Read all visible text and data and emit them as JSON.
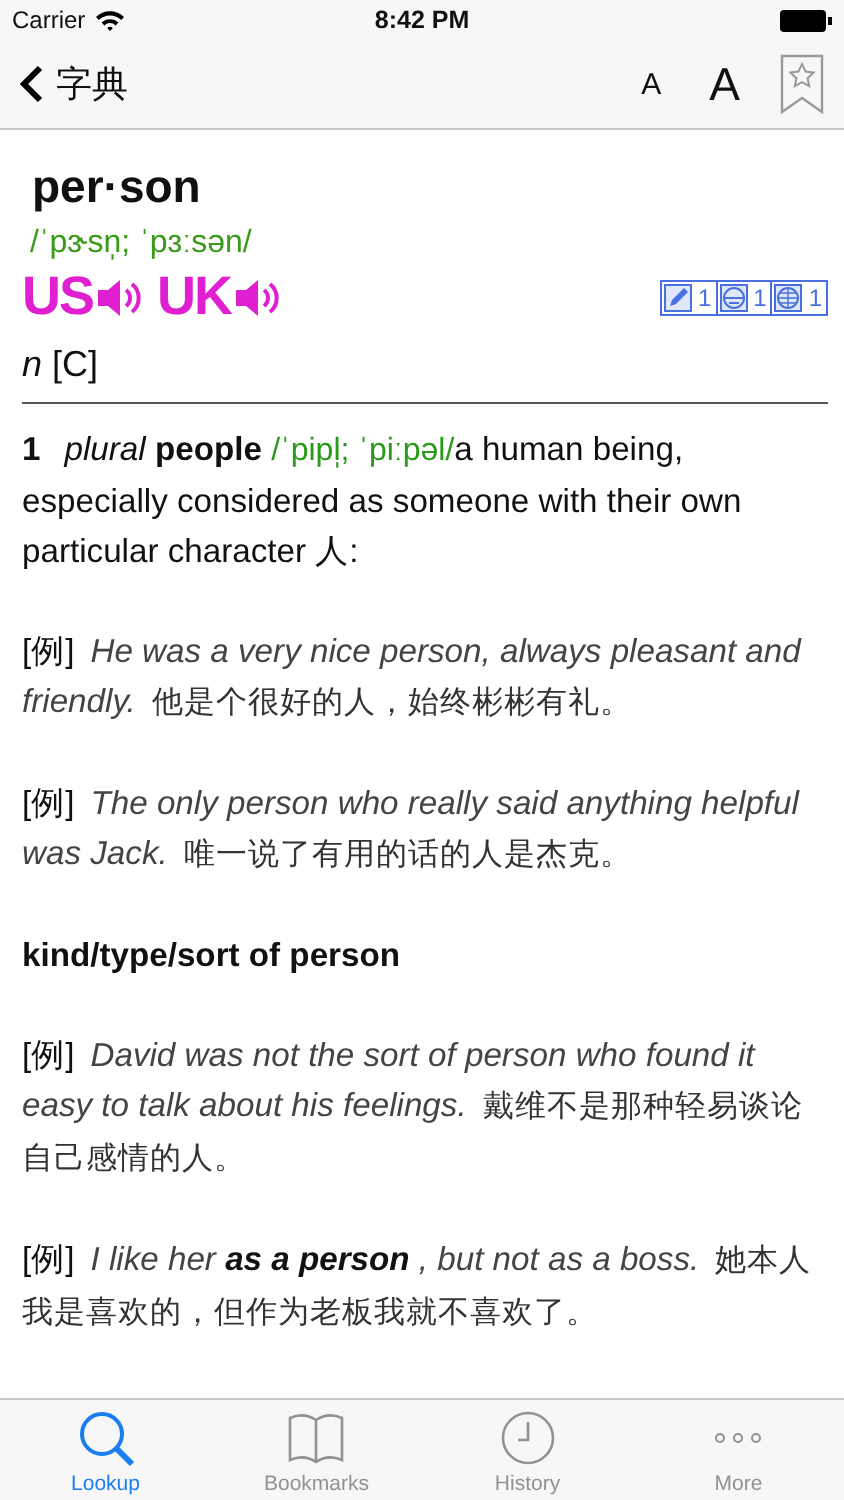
{
  "status_bar": {
    "carrier": "Carrier",
    "time": "8:42 PM"
  },
  "nav_bar": {
    "back_label": "字典",
    "font_buttons": [
      {
        "label": "A",
        "kind": "smaller"
      },
      {
        "label": "A",
        "kind": "larger"
      }
    ],
    "bookmarked": false
  },
  "entry": {
    "headword": "per·son",
    "pronunciation": "/ˈpɝsn̩; ˈpɜːsən/",
    "audio": [
      {
        "label": "US"
      },
      {
        "label": "UK"
      }
    ],
    "counters": [
      {
        "kind": "pencil",
        "count": "1"
      },
      {
        "kind": "face",
        "count": "1"
      },
      {
        "kind": "globe",
        "count": "1"
      }
    ],
    "part_of_speech": "n",
    "grammar": "[C]",
    "sections": [
      {
        "kind": "sense",
        "number": "1",
        "grammar": "plural",
        "form": "people",
        "pronunciation": "/ˈpipl̩; ˈpiːpəl/",
        "definition": "a human being, especially considered as someone with their own particular character 人:"
      },
      {
        "kind": "example",
        "marker": "[例]",
        "english": "He was a very nice person, always pleasant and friendly.",
        "chinese": "他是个很好的人，始终彬彬有礼。"
      },
      {
        "kind": "example",
        "marker": "[例]",
        "english": "The only person who really said anything helpful was Jack.",
        "chinese": "唯一说了有用的话的人是杰克。"
      },
      {
        "kind": "phrase",
        "text": "kind/type/sort of person"
      },
      {
        "kind": "example",
        "marker": "[例]",
        "english": "David was not the sort of person who found it easy to talk about his feelings.",
        "chinese": "戴维不是那种轻易谈论自己感情的人。"
      },
      {
        "kind": "example",
        "marker": "[例]",
        "english": "I like her **as a person** , but not as a boss.",
        "chinese": "她本人我是喜欢的，但作为老板我就不喜欢了。"
      }
    ]
  },
  "tab_bar": [
    {
      "kind": "lookup",
      "label": "Lookup",
      "selected": true
    },
    {
      "kind": "bookmarks",
      "label": "Bookmarks",
      "selected": false
    },
    {
      "kind": "history",
      "label": "History",
      "selected": false
    },
    {
      "kind": "more",
      "label": "More",
      "selected": false
    }
  ]
}
